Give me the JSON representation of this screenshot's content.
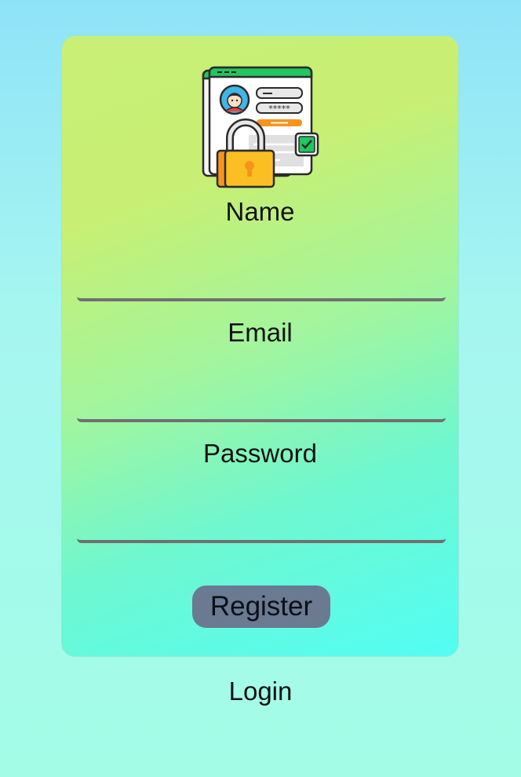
{
  "form": {
    "name_label": "Name",
    "name_value": "",
    "email_label": "Email",
    "email_value": "",
    "password_label": "Password",
    "password_value": "",
    "register_label": "Register"
  },
  "footer": {
    "login_label": "Login"
  },
  "illustration": {
    "icon": "secure-login-illustration"
  }
}
